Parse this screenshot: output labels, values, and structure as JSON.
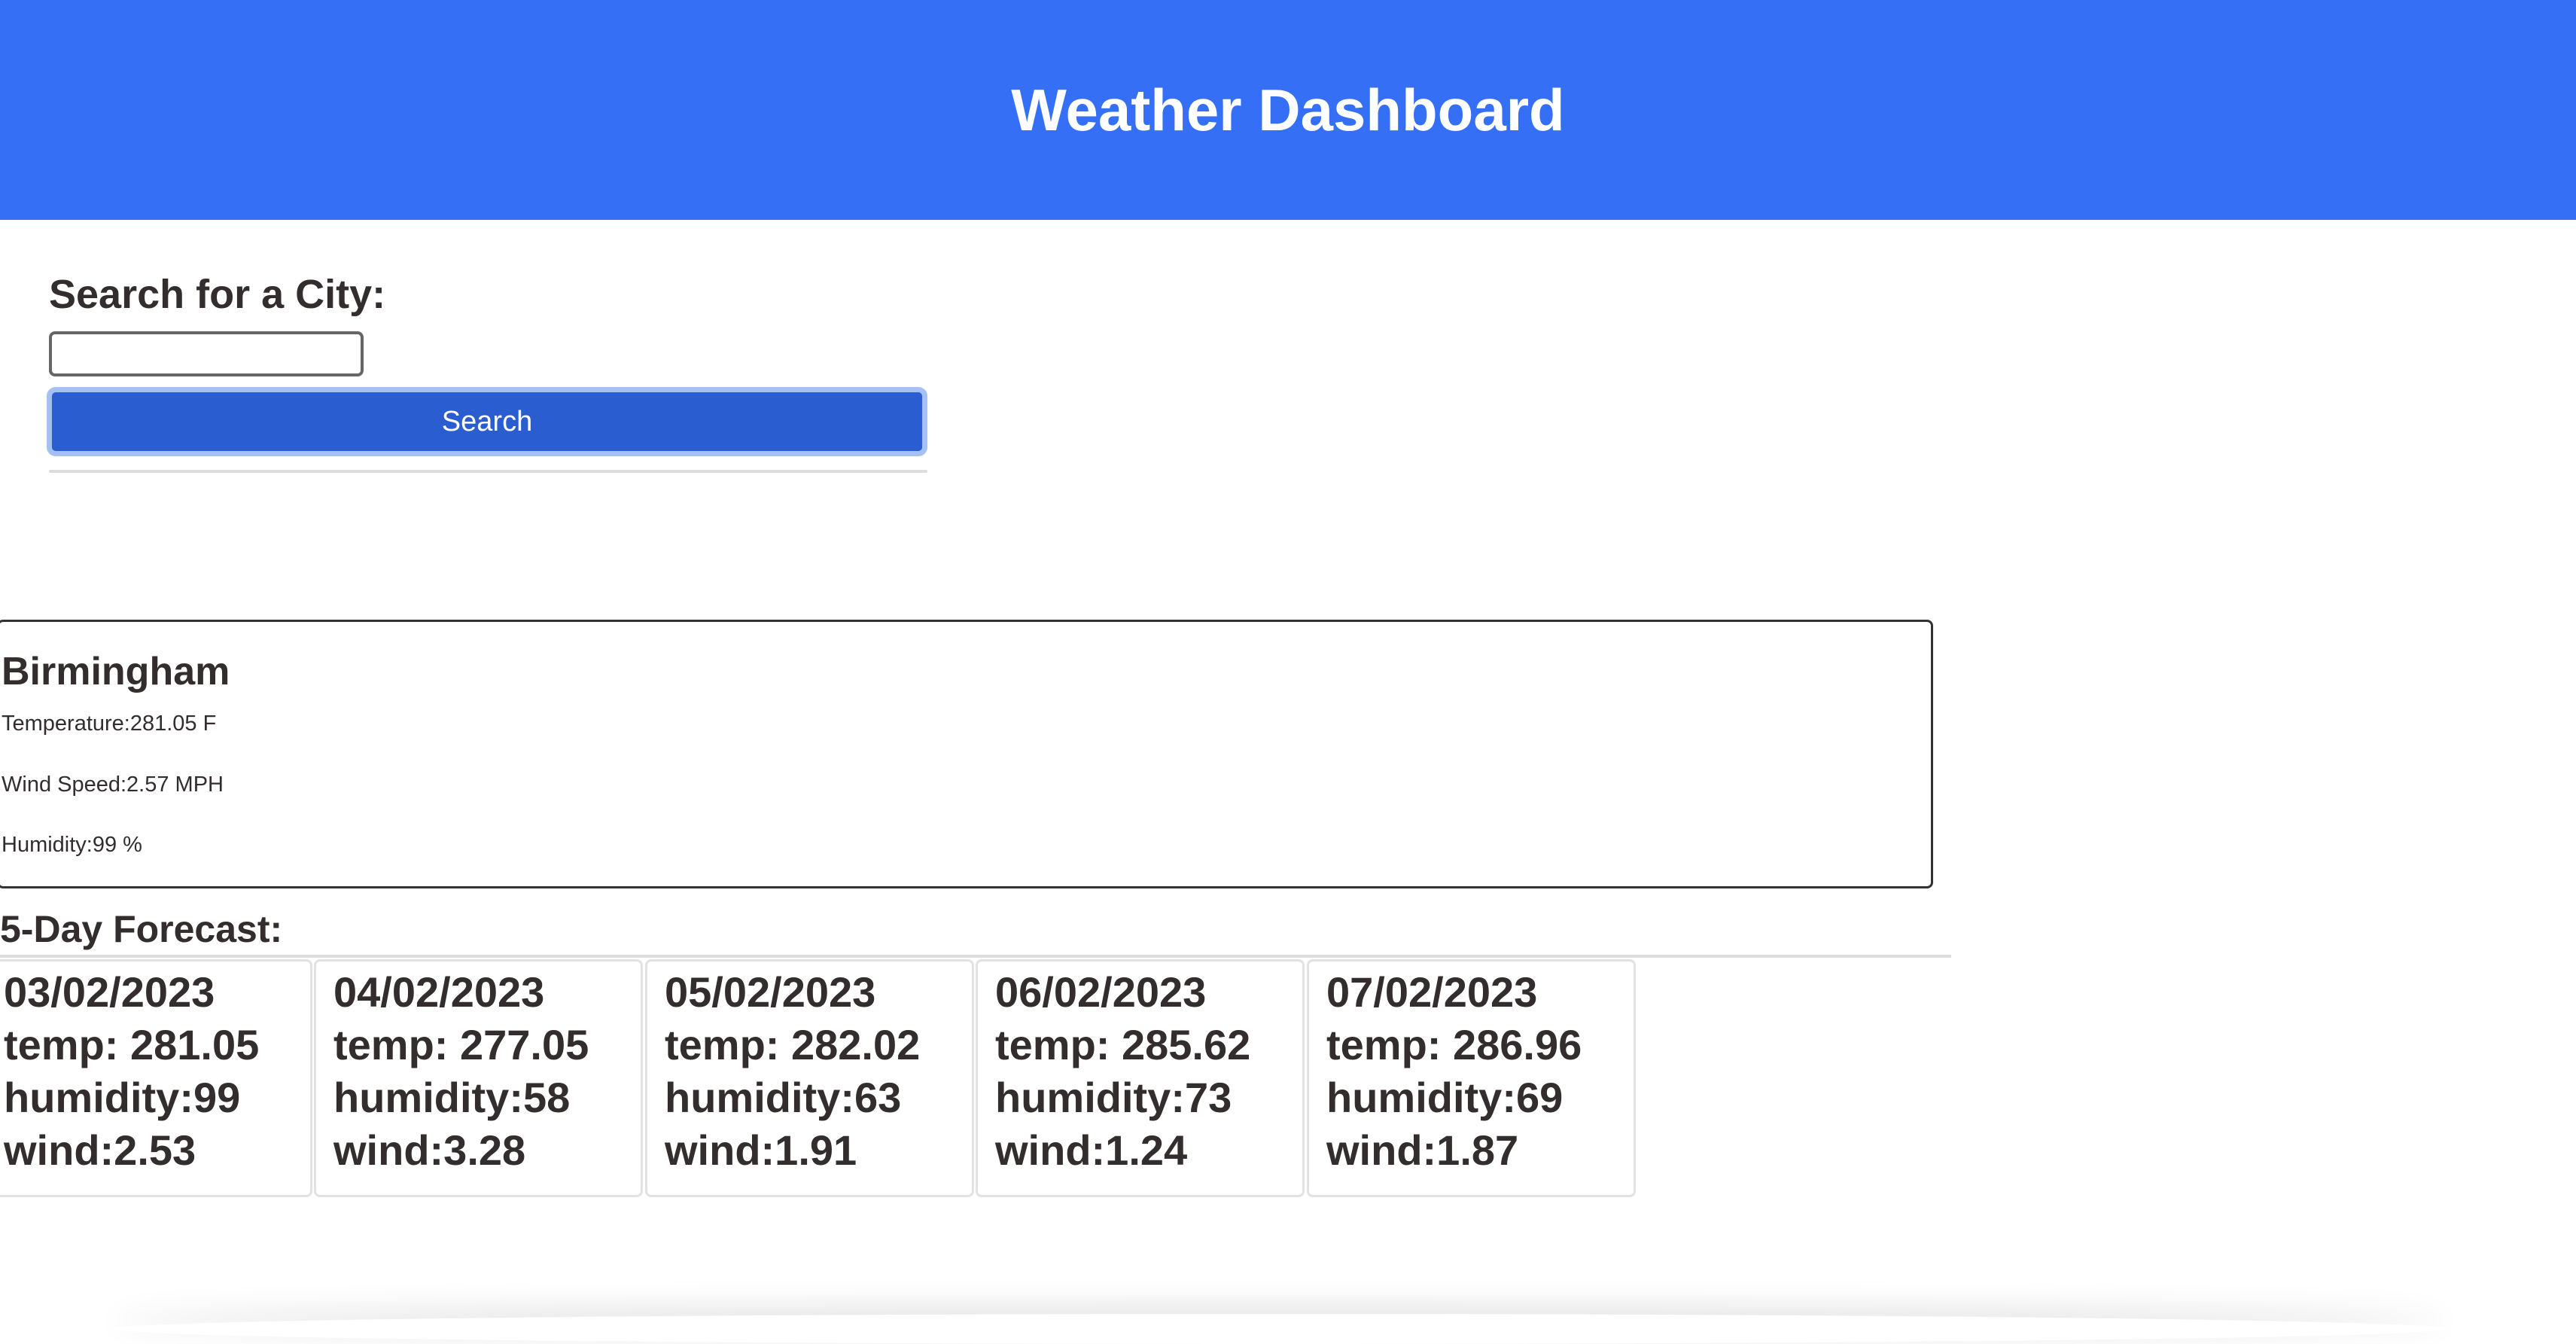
{
  "header": {
    "title": "Weather Dashboard"
  },
  "search": {
    "label": "Search for a City:",
    "value": "",
    "button_label": "Search"
  },
  "current": {
    "city": "Birmingham",
    "temperature": "Temperature:281.05 F",
    "wind": "Wind Speed:2.57 MPH",
    "humidity": "Humidity:99 %"
  },
  "forecast": {
    "title": "5-Day Forecast:",
    "days": [
      {
        "date": "03/02/2023",
        "temp": "temp: 281.05",
        "humidity": "humidity:99",
        "wind": "wind:2.53"
      },
      {
        "date": "04/02/2023",
        "temp": "temp: 277.05",
        "humidity": "humidity:58",
        "wind": "wind:3.28"
      },
      {
        "date": "05/02/2023",
        "temp": "temp: 282.02",
        "humidity": "humidity:63",
        "wind": "wind:1.91"
      },
      {
        "date": "06/02/2023",
        "temp": "temp: 285.62",
        "humidity": "humidity:73",
        "wind": "wind:1.24"
      },
      {
        "date": "07/02/2023",
        "temp": "temp: 286.96",
        "humidity": "humidity:69",
        "wind": "wind:1.87"
      }
    ]
  },
  "colors": {
    "header": "#346ff5",
    "button": "#2a5dd0",
    "button_outline": "#a5c0f7",
    "text": "#332d2d"
  }
}
